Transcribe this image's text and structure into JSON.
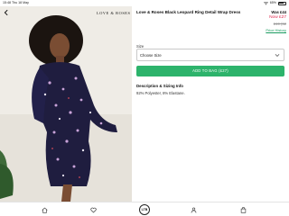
{
  "status_bar": {
    "time": "15:48",
    "date": "Thu 18 May",
    "battery": "65%",
    "battery_level": 0.65
  },
  "brand": {
    "logo_text": "LOVE & ROSES"
  },
  "product": {
    "title": "Love & Roses Black Leopard Ring Detail Wrap Dress",
    "was_price": "Was £44",
    "now_price": "Now £27",
    "original_price": "£19 (62",
    "price_history_link": "Price History"
  },
  "size": {
    "label": "Size",
    "selected": "Choose Size"
  },
  "add_to_bag": {
    "label": "ADD TO BAG (£27)"
  },
  "description": {
    "title": "Description & Sizing Info",
    "text": "92% Polyester, 8% Elastane."
  },
  "bottom_nav": {
    "center_badge": "LTB"
  },
  "colors": {
    "accent_green": "#2db36b",
    "sale_red": "#e0264c",
    "link_green": "#1a9b60"
  },
  "icons": [
    "back-icon",
    "chevron-down-icon",
    "home-icon",
    "heart-icon",
    "user-icon",
    "bag-icon",
    "wifi-icon",
    "battery-icon"
  ]
}
